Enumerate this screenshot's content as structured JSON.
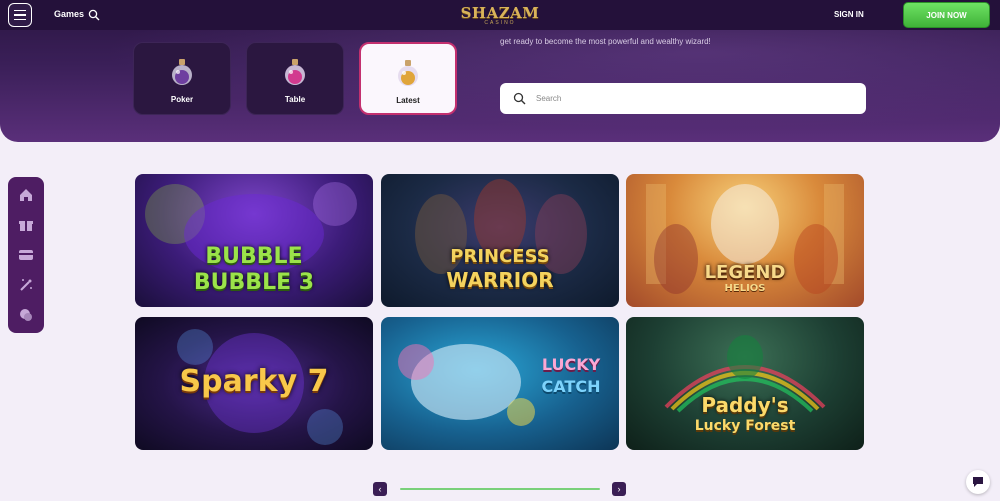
{
  "header": {
    "menu_icon": "hamburger-menu-icon",
    "games_label": "Games",
    "search_icon": "search-icon",
    "logo_text": "SHAZAM",
    "logo_subtext": "CASINO",
    "signin_label": "SIGN IN",
    "join_label": "JOIN NOW",
    "join_color": "#4ccb43"
  },
  "hero": {
    "tagline": "get ready to become the most powerful and wealthy wizard!"
  },
  "categories": [
    {
      "label": "Poker",
      "icon": "potion-icon",
      "active": false
    },
    {
      "label": "Table",
      "icon": "potion-icon",
      "active": false
    },
    {
      "label": "Latest",
      "icon": "potion-icon",
      "active": true
    }
  ],
  "search": {
    "placeholder": "Search",
    "value": ""
  },
  "sidebar": {
    "items": [
      {
        "icon": "home-icon"
      },
      {
        "icon": "gift-icon"
      },
      {
        "icon": "card-icon"
      },
      {
        "icon": "magic-wand-icon"
      },
      {
        "icon": "chat-icon"
      }
    ]
  },
  "games": [
    {
      "title_line1": "BUBBLE",
      "title_line2": "BUBBLE 3"
    },
    {
      "title_line1": "PRINCESS",
      "title_line2": "WARRIOR"
    },
    {
      "title_line1": "LEGEND",
      "title_line2": "HELIOS"
    },
    {
      "title_line1": "Sparky 7",
      "title_line2": ""
    },
    {
      "title_line1": "LUCKY",
      "title_line2": "CATCH"
    },
    {
      "title_line1": "Paddy's",
      "title_line2": "Lucky Forest"
    }
  ],
  "pager": {
    "prev_label": "‹",
    "next_label": "›"
  },
  "chat": {
    "icon": "chat-bubble-icon"
  }
}
